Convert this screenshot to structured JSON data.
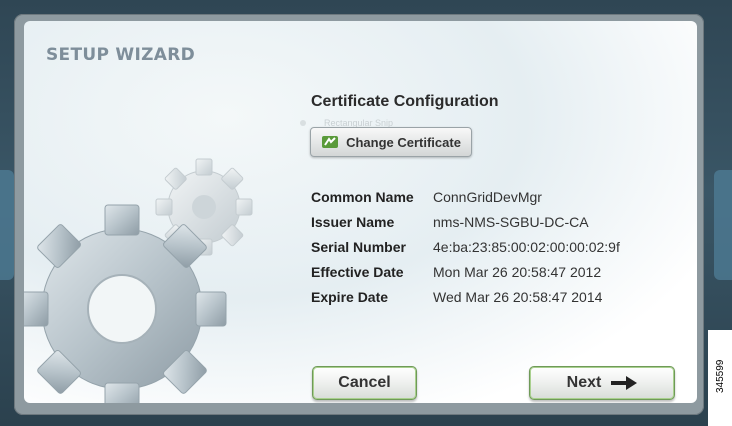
{
  "wizard": {
    "title": "SETUP WIZARD",
    "heading": "Certificate Configuration",
    "ghost_text": "Rectangular Snip",
    "change_certificate_label": "Change Certificate",
    "fields": [
      {
        "label": "Common Name",
        "value": "ConnGridDevMgr"
      },
      {
        "label": "Issuer Name",
        "value": "nms-NMS-SGBU-DC-CA"
      },
      {
        "label": "Serial Number",
        "value": "4e:ba:23:85:00:02:00:00:02:9f"
      },
      {
        "label": "Effective Date",
        "value": "Mon Mar 26 20:58:47 2012"
      },
      {
        "label": "Expire Date",
        "value": "Wed Mar 26 20:58:47 2014"
      }
    ],
    "cancel_label": "Cancel",
    "next_label": "Next"
  },
  "figure_id": "345599",
  "icons": {
    "gears": "gears-illustration",
    "certificate": "certificate-icon",
    "next": "arrow-right-icon"
  },
  "colors": {
    "title": "#7e8e9a",
    "button_border": "#6f9a58",
    "certificate_icon": "#5a9a3a"
  }
}
